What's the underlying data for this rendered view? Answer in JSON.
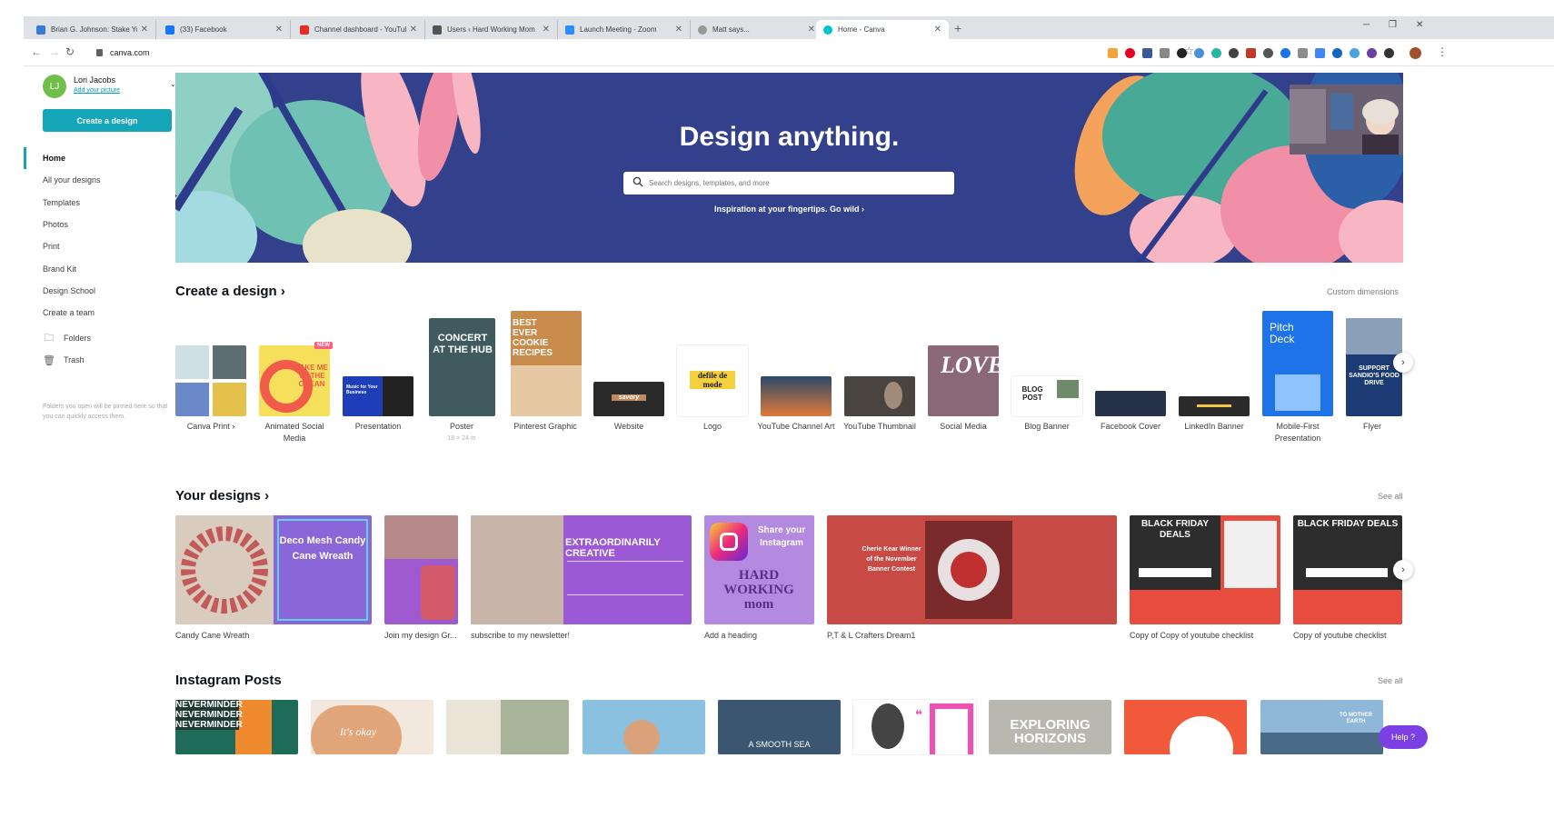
{
  "tabs": [
    {
      "title": "Brian G. Johnson: Stake Your Cla",
      "color": "#3b7bd8"
    },
    {
      "title": "(33) Facebook",
      "color": "#1877f2"
    },
    {
      "title": "Channel dashboard - YouTube St",
      "color": "#e52d27"
    },
    {
      "title": "Users ‹ Hard Working Mom",
      "color": "#555555"
    },
    {
      "title": "Launch Meeting - Zoom",
      "color": "#2d8cff"
    },
    {
      "title": "Matt says...",
      "color": "#999999"
    },
    {
      "title": "Home - Canva",
      "color": "#00c4cc"
    }
  ],
  "address": {
    "url": "canva.com"
  },
  "user": {
    "initials": "LJ",
    "name": "Lori Jacobs",
    "add_picture": "Add your picture"
  },
  "sidebar": {
    "create_label": "Create a design",
    "items": [
      "Home",
      "All your designs",
      "Templates",
      "Photos",
      "Print",
      "Brand Kit",
      "Design School",
      "Create a team"
    ],
    "folders_label": "Folders",
    "trash_label": "Trash",
    "hint": "Folders you open will be pinned here so that you can quickly access them."
  },
  "hero": {
    "title": "Design anything.",
    "search_placeholder": "Search designs, templates, and more",
    "inspiration": "Inspiration at your fingertips. Go wild ›"
  },
  "create_section": {
    "title": "Create a design ›",
    "custom": "Custom dimensions",
    "new_badge": "NEW",
    "poster_size": "18 × 24 in",
    "items": [
      {
        "label": "Canva Print ›"
      },
      {
        "label": "Animated Social Media",
        "text": "TAKE ME TO THE OCEAN"
      },
      {
        "label": "Presentation",
        "text": "Music for Your Business"
      },
      {
        "label": "Poster",
        "text": "CONCERT AT THE HUB"
      },
      {
        "label": "Pinterest Graphic",
        "text": "BEST EVER COOKIE RECIPES"
      },
      {
        "label": "Website",
        "text": "savory"
      },
      {
        "label": "Logo",
        "text": "defile de mode"
      },
      {
        "label": "YouTube Channel Art"
      },
      {
        "label": "YouTube Thumbnail"
      },
      {
        "label": "Social Media",
        "text": "LOVE"
      },
      {
        "label": "Blog Banner",
        "text": "BLOG POST"
      },
      {
        "label": "Facebook Cover"
      },
      {
        "label": "LinkedIn Banner"
      },
      {
        "label": "Mobile-First Presentation",
        "text": "Pitch Deck"
      },
      {
        "label": "Flyer",
        "text": "SUPPORT SANDIO'S FOOD DRIVE"
      }
    ]
  },
  "your_designs": {
    "title": "Your designs ›",
    "see_all": "See all",
    "items": [
      {
        "label": "Candy Cane Wreath",
        "text": "Deco Mesh Candy Cane Wreath"
      },
      {
        "label": "Join my design Gr..."
      },
      {
        "label": "subscribe to my newsletter!",
        "text": "EXTRAORDINARILY CREATIVE"
      },
      {
        "label": "Add a heading",
        "text": "Share your Instagram",
        "text2": "HARD WORKING mom"
      },
      {
        "label": "P,T & L Crafters Dream1",
        "text": "Cherie Kear Winner of the November Banner Contest"
      },
      {
        "label": "Copy of Copy of youtube checklist",
        "text": "BLACK FRIDAY DEALS"
      },
      {
        "label": "Copy of youtube checklist",
        "text": "BLACK FRIDAY DEALS"
      }
    ]
  },
  "instagram": {
    "title": "Instagram Posts",
    "see_all": "See all",
    "items": [
      {
        "text": "NEVERMINDER NEVERMINDER NEVERMINDER"
      },
      {
        "text": "It's okay"
      },
      {
        "text": ""
      },
      {
        "text": ""
      },
      {
        "text": "A SMOOTH SEA"
      },
      {
        "text": ""
      },
      {
        "text": "EXPLORING HORIZONS"
      },
      {
        "text": ""
      },
      {
        "text": "TO MOTHER EARTH"
      }
    ]
  },
  "help": {
    "label": "Help ?"
  }
}
